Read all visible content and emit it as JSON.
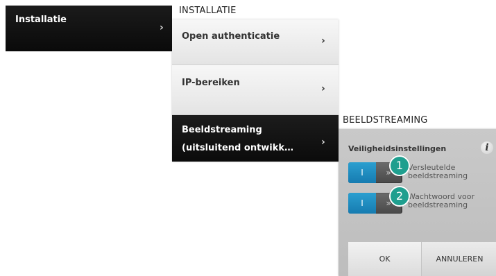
{
  "left_menu": {
    "item_label": "Installatie",
    "chevron": "›"
  },
  "installatie": {
    "title": "INSTALLATIE",
    "items": [
      {
        "label_line1": "Open authenticatie",
        "label_line2": "",
        "chevron": "›"
      },
      {
        "label_line1": "IP-bereiken",
        "label_line2": "",
        "chevron": "›"
      },
      {
        "label_line1": "Beeldstreaming",
        "label_line2": "(uitsluitend ontwikk…",
        "chevron": "›"
      }
    ]
  },
  "beeldstreaming": {
    "title": "BEELDSTREAMING",
    "section_title": "Veiligheidsinstellingen",
    "info_icon": "i",
    "toggles": [
      {
        "on_label": "I",
        "handle_glyph": "»",
        "label_line1": "Versleutelde",
        "label_line2": "beeldstreaming",
        "badge": "1"
      },
      {
        "on_label": "I",
        "handle_glyph": "»",
        "label_line1": "Wachtwoord voor",
        "label_line2": "beeldstreaming",
        "badge": "2"
      }
    ],
    "ok_label": "OK",
    "cancel_label": "ANNULEREN"
  },
  "colors": {
    "toggle_on": "#2b9fd0",
    "badge": "#1f9f8f",
    "dark_panel": "#111111"
  }
}
